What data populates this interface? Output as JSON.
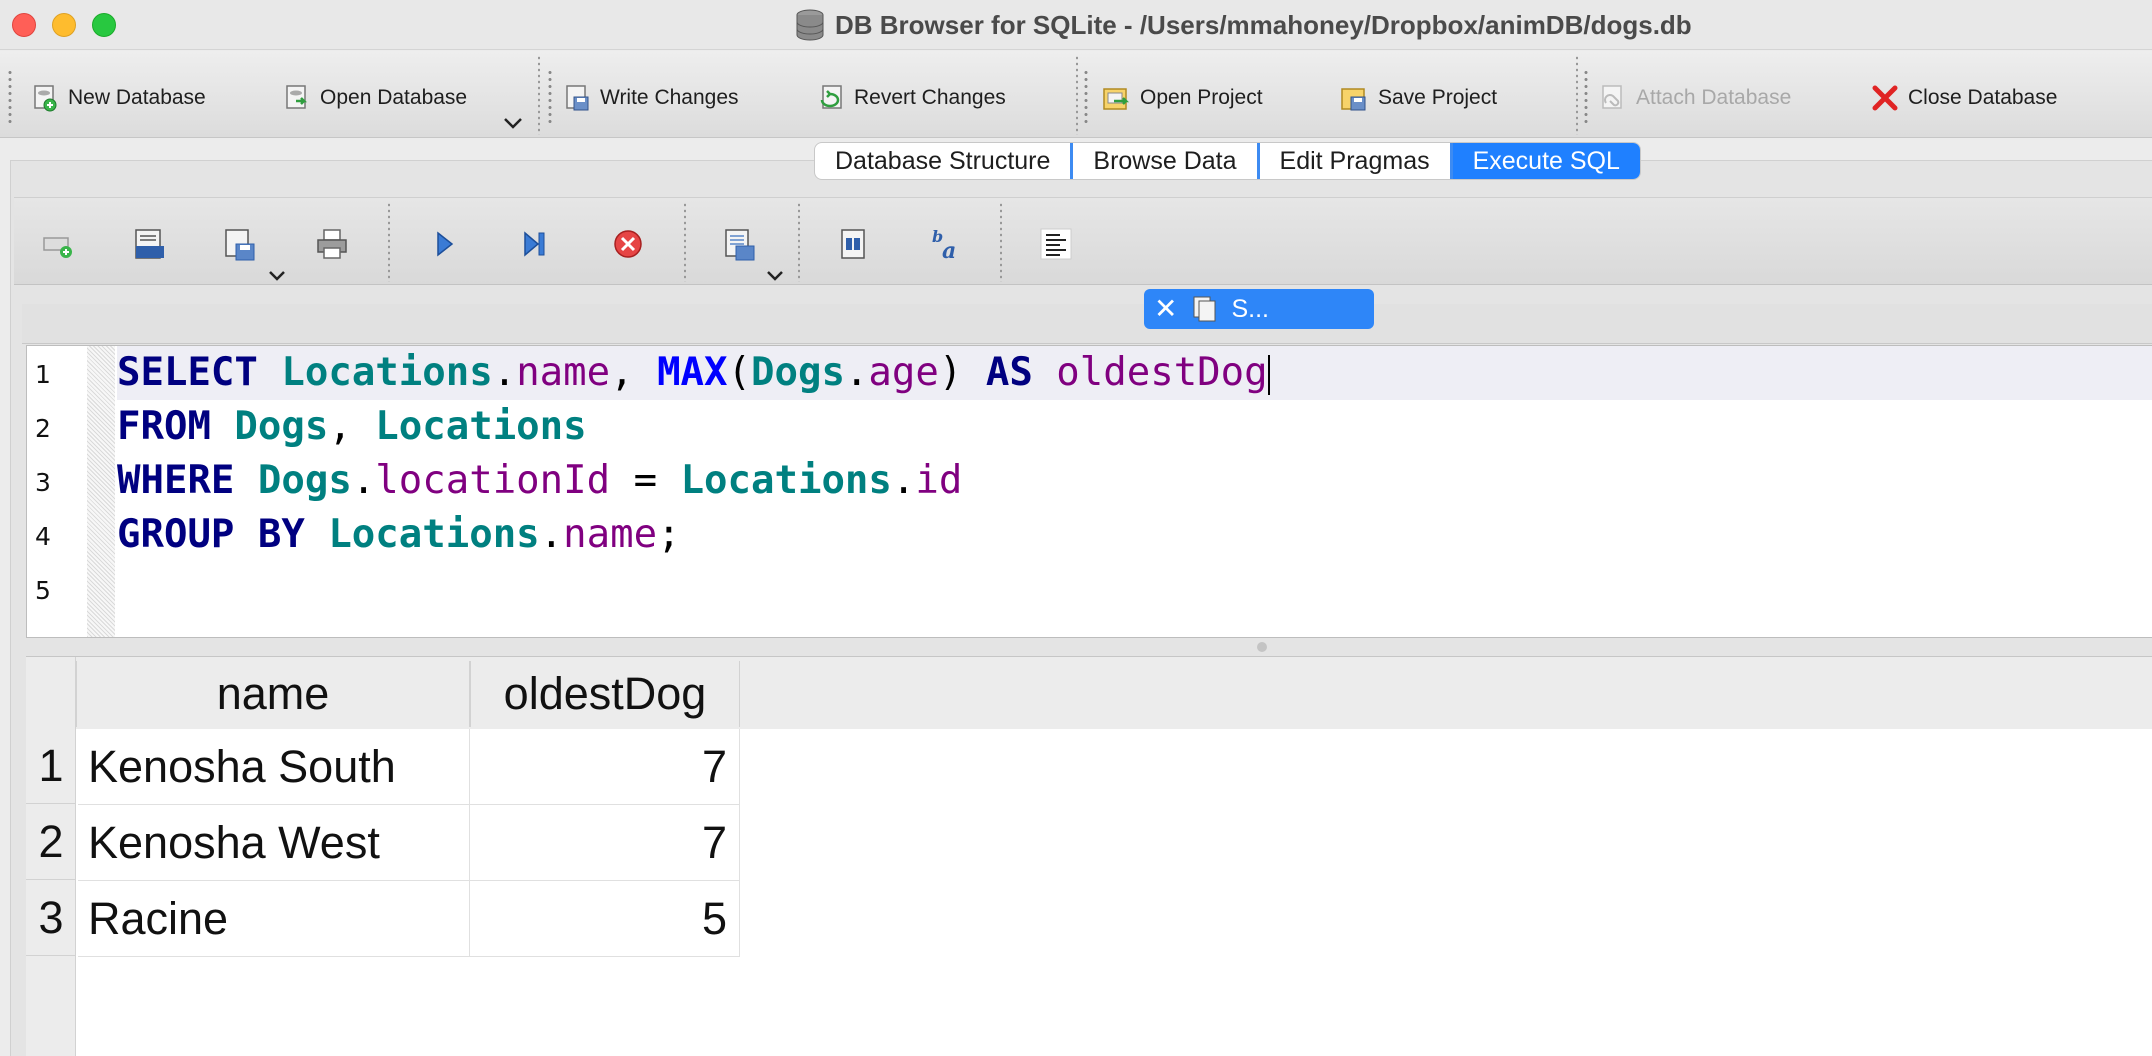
{
  "window": {
    "title": "DB Browser for SQLite - /Users/mmahoney/Dropbox/animDB/dogs.db"
  },
  "toolbar": {
    "new_database": "New Database",
    "open_database": "Open Database",
    "write_changes": "Write Changes",
    "revert_changes": "Revert Changes",
    "open_project": "Open Project",
    "save_project": "Save Project",
    "attach_database": "Attach Database",
    "close_database": "Close Database"
  },
  "tabs": {
    "database_structure": "Database Structure",
    "browse_data": "Browse Data",
    "edit_pragmas": "Edit Pragmas",
    "execute_sql": "Execute SQL",
    "active": "Execute SQL"
  },
  "editor_tab": {
    "close": "✕",
    "label": "S..."
  },
  "editor": {
    "line_numbers": [
      "1",
      "2",
      "3",
      "4",
      "5"
    ],
    "tokens": {
      "select": "SELECT",
      "locations": "Locations",
      "dot": ".",
      "name": "name",
      "comma": ",",
      "max": "MAX",
      "lparen": "(",
      "dogs": "Dogs",
      "age": "age",
      "rparen": ")",
      "as": "AS",
      "oldest_dog": "oldestDog",
      "from": "FROM",
      "where": "WHERE",
      "location_id": "locationId",
      "equals": "=",
      "id": "id",
      "group_by": "GROUP BY",
      "semicolon": ";"
    }
  },
  "results": {
    "columns": [
      "name",
      "oldestDog"
    ],
    "rows": [
      {
        "num": "1",
        "name": "Kenosha South",
        "oldestDog": "7"
      },
      {
        "num": "2",
        "name": "Kenosha West",
        "oldestDog": "7"
      },
      {
        "num": "3",
        "name": "Racine",
        "oldestDog": "5"
      }
    ]
  },
  "colors": {
    "keyword": "#000080",
    "function": "#0000ff",
    "table": "#008080",
    "column": "#800080",
    "active_tab": "#1f80ff"
  }
}
